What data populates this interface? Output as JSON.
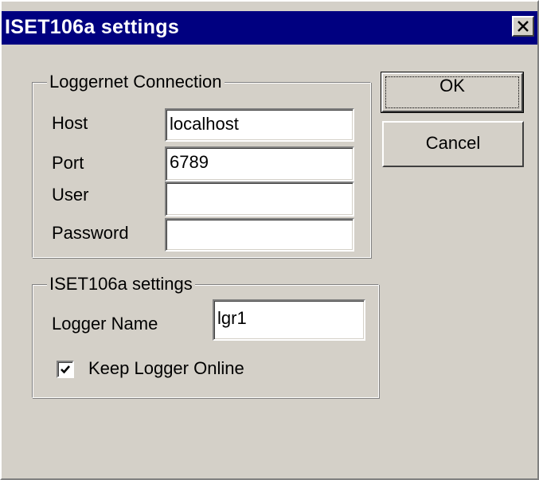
{
  "window": {
    "title": "ISET106a settings"
  },
  "loggernet": {
    "legend": "Loggernet Connection",
    "host_label": "Host",
    "host_value": "localhost",
    "port_label": "Port",
    "port_value": "6789",
    "user_label": "User",
    "user_value": "",
    "password_label": "Password",
    "password_value": ""
  },
  "iset": {
    "legend": "ISET106a settings",
    "logger_name_label": "Logger Name",
    "logger_name_value": "lgr1",
    "keep_online_label": "Keep Logger Online",
    "keep_online_checked": true
  },
  "buttons": {
    "ok_label": "OK",
    "cancel_label": "Cancel"
  },
  "icons": {
    "close": "close-icon",
    "check": "checkmark-icon"
  },
  "colors": {
    "titlebar": "#000080",
    "face": "#d4d0c8"
  }
}
